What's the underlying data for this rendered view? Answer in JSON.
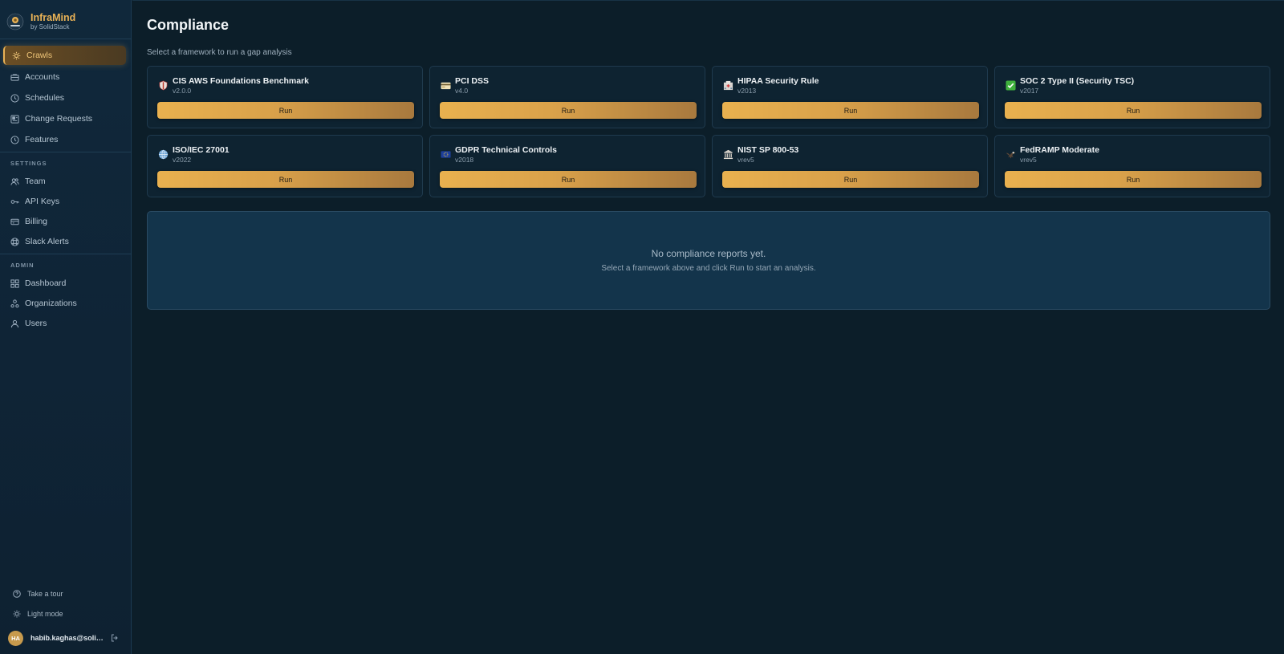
{
  "brand": {
    "name": "InfraMind",
    "subtitle": "by SolidStack",
    "accent_color": "#e9b256"
  },
  "sidebar": {
    "main_items": [
      {
        "label": "Crawls",
        "icon": "crawl-icon",
        "active": true
      },
      {
        "label": "Accounts",
        "icon": "accounts-icon"
      },
      {
        "label": "Schedules",
        "icon": "clock-icon"
      },
      {
        "label": "Change Requests",
        "icon": "change-requests-icon"
      },
      {
        "label": "Features",
        "icon": "features-icon"
      }
    ],
    "settings_heading": "SETTINGS",
    "settings_items": [
      {
        "label": "Team",
        "icon": "team-icon"
      },
      {
        "label": "API Keys",
        "icon": "key-icon"
      },
      {
        "label": "Billing",
        "icon": "billing-icon"
      },
      {
        "label": "Slack Alerts",
        "icon": "slack-icon"
      }
    ],
    "admin_heading": "ADMIN",
    "admin_items": [
      {
        "label": "Dashboard",
        "icon": "dashboard-icon"
      },
      {
        "label": "Organizations",
        "icon": "organizations-icon"
      },
      {
        "label": "Users",
        "icon": "user-icon"
      }
    ],
    "footer": {
      "tour_label": "Take a tour",
      "theme_label": "Light mode",
      "user_initials": "HA",
      "user_email": "habib.kaghas@solid..."
    }
  },
  "page": {
    "title": "Compliance",
    "subtitle": "Select a framework to run a gap analysis",
    "run_label": "Run",
    "frameworks": [
      {
        "name": "CIS AWS Foundations Benchmark",
        "version": "v2.0.0",
        "icon": "shield-icon"
      },
      {
        "name": "PCI DSS",
        "version": "v4.0",
        "icon": "credit-card-icon"
      },
      {
        "name": "HIPAA Security Rule",
        "version": "v2013",
        "icon": "hospital-icon"
      },
      {
        "name": "SOC 2 Type II (Security TSC)",
        "version": "v2017",
        "icon": "check-mark-icon"
      },
      {
        "name": "ISO/IEC 27001",
        "version": "v2022",
        "icon": "globe-icon"
      },
      {
        "name": "GDPR Technical Controls",
        "version": "v2018",
        "icon": "eu-flag-icon"
      },
      {
        "name": "NIST SP 800-53",
        "version": "vrev5",
        "icon": "classical-building-icon"
      },
      {
        "name": "FedRAMP Moderate",
        "version": "vrev5",
        "icon": "eagle-icon"
      }
    ],
    "empty_state": {
      "title": "No compliance reports yet.",
      "description": "Select a framework above and click Run to start an analysis."
    }
  }
}
